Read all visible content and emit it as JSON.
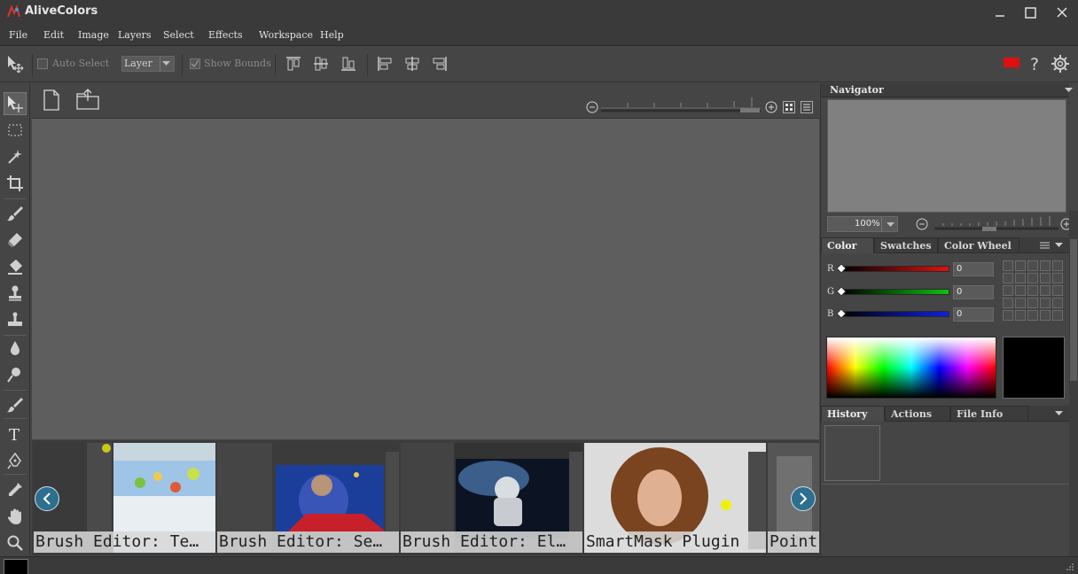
{
  "app": {
    "title": "AliveColors"
  },
  "menu": [
    "File",
    "Edit",
    "Image",
    "Layers",
    "Select",
    "Effects",
    "Workspace",
    "Help"
  ],
  "options": {
    "auto_select_label": "Auto Select",
    "layer_select_value": "Layer",
    "show_bounds_label": "Show Bounds"
  },
  "navigator": {
    "title": "Navigator",
    "zoom_value": "100%"
  },
  "color_panel": {
    "tabs": [
      "Color",
      "Swatches",
      "Color Wheel"
    ],
    "channels": [
      {
        "label": "R",
        "value": "0",
        "color": "#e01010"
      },
      {
        "label": "G",
        "value": "0",
        "color": "#10c010"
      },
      {
        "label": "B",
        "value": "0",
        "color": "#1020e0"
      }
    ],
    "current_color": "#000000"
  },
  "history_panel": {
    "tabs": [
      "History",
      "Actions",
      "File Info"
    ]
  },
  "filmstrip": {
    "items": [
      {
        "caption": "Brush Editor: Te…"
      },
      {
        "caption": "Brush Editor: Se…"
      },
      {
        "caption": "Brush Editor: El…"
      },
      {
        "caption": "SmartMask Plugin"
      },
      {
        "caption": "Point"
      }
    ]
  },
  "colors": {
    "accent": "#2d6f8c",
    "notification": "#e01010"
  }
}
